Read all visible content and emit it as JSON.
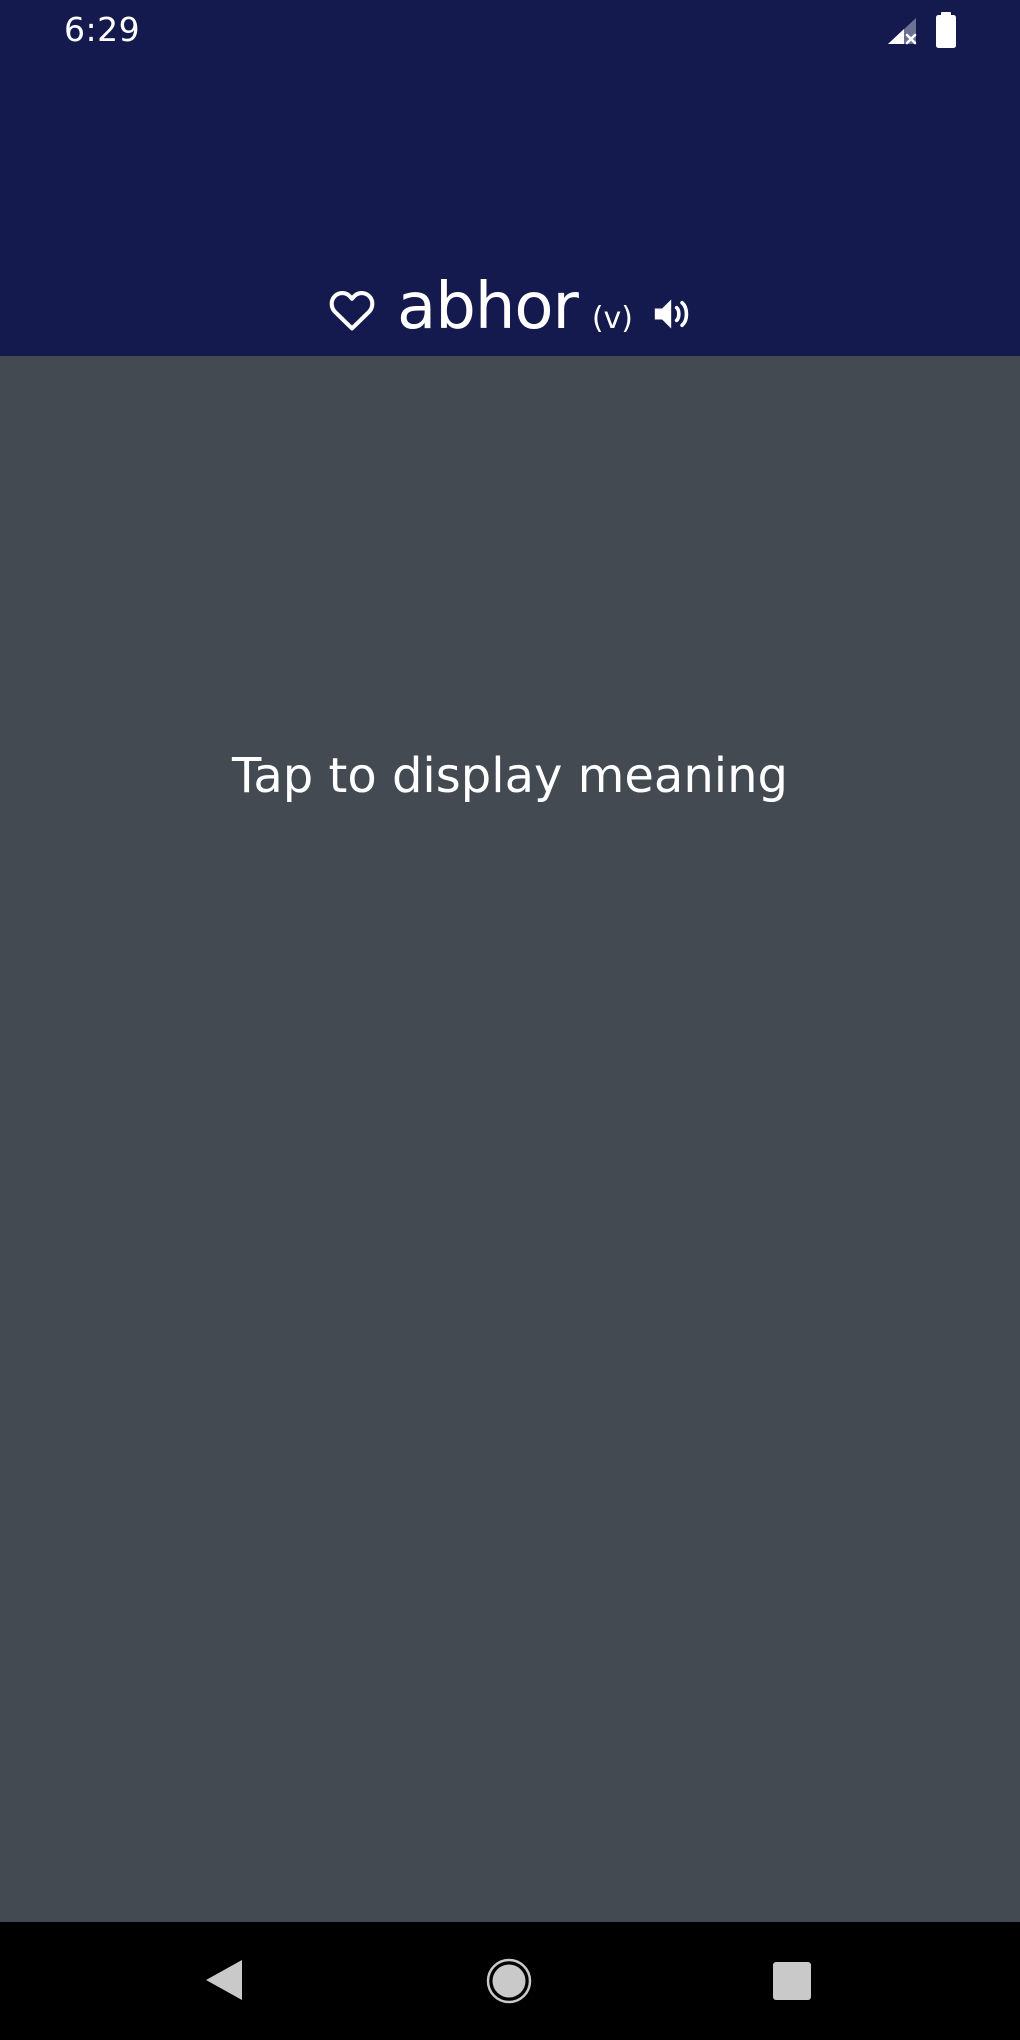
{
  "status_bar": {
    "time": "6:29",
    "signal_icon": "signal-no-data-icon",
    "battery_icon": "battery-full-icon"
  },
  "header": {
    "favorite_icon": "heart-outline-icon",
    "word": "abhor",
    "part_of_speech": "(v)",
    "speaker_icon": "speaker-volume-icon"
  },
  "content": {
    "prompt": "Tap to display meaning"
  },
  "nav_bar": {
    "back_icon": "back-triangle-icon",
    "home_icon": "home-circle-icon",
    "recents_icon": "recents-square-icon"
  },
  "colors": {
    "header_bg": "#141a4d",
    "content_bg": "#434a52",
    "nav_bg": "#000000",
    "text": "#ffffff"
  }
}
